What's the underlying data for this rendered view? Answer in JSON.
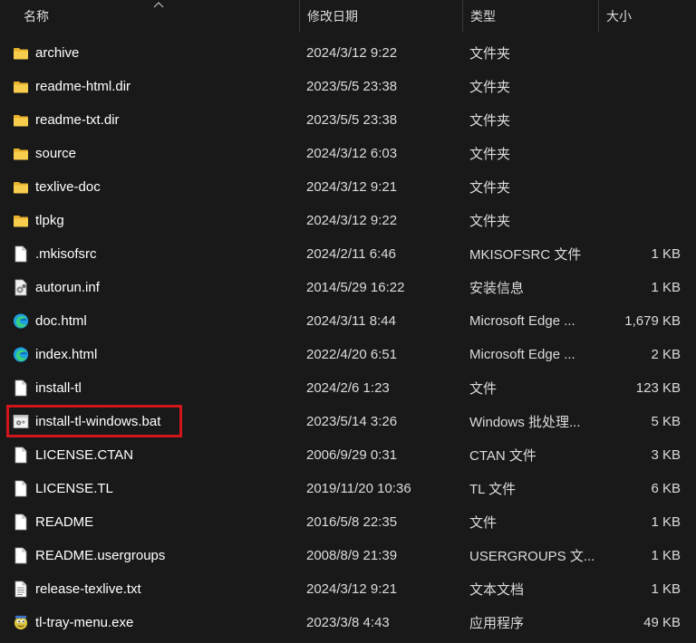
{
  "columns": {
    "name": "名称",
    "date": "修改日期",
    "type": "类型",
    "size": "大小"
  },
  "files": [
    {
      "name": "archive",
      "date": "2024/3/12 9:22",
      "type": "文件夹",
      "size": "",
      "icon": "folder-icon"
    },
    {
      "name": "readme-html.dir",
      "date": "2023/5/5 23:38",
      "type": "文件夹",
      "size": "",
      "icon": "folder-icon"
    },
    {
      "name": "readme-txt.dir",
      "date": "2023/5/5 23:38",
      "type": "文件夹",
      "size": "",
      "icon": "folder-icon"
    },
    {
      "name": "source",
      "date": "2024/3/12 6:03",
      "type": "文件夹",
      "size": "",
      "icon": "folder-icon"
    },
    {
      "name": "texlive-doc",
      "date": "2024/3/12 9:21",
      "type": "文件夹",
      "size": "",
      "icon": "folder-icon"
    },
    {
      "name": "tlpkg",
      "date": "2024/3/12 9:22",
      "type": "文件夹",
      "size": "",
      "icon": "folder-icon"
    },
    {
      "name": ".mkisofsrc",
      "date": "2024/2/11 6:46",
      "type": "MKISOFSRC 文件",
      "size": "1 KB",
      "icon": "file-icon"
    },
    {
      "name": "autorun.inf",
      "date": "2014/5/29 16:22",
      "type": "安装信息",
      "size": "1 KB",
      "icon": "settings-file-icon"
    },
    {
      "name": "doc.html",
      "date": "2024/3/11 8:44",
      "type": "Microsoft Edge ...",
      "size": "1,679 KB",
      "icon": "edge-icon"
    },
    {
      "name": "index.html",
      "date": "2022/4/20 6:51",
      "type": "Microsoft Edge ...",
      "size": "2 KB",
      "icon": "edge-icon"
    },
    {
      "name": "install-tl",
      "date": "2024/2/6 1:23",
      "type": "文件",
      "size": "123 KB",
      "icon": "file-icon"
    },
    {
      "name": "install-tl-windows.bat",
      "date": "2023/5/14 3:26",
      "type": "Windows 批处理...",
      "size": "5 KB",
      "icon": "batch-file-icon"
    },
    {
      "name": "LICENSE.CTAN",
      "date": "2006/9/29 0:31",
      "type": "CTAN 文件",
      "size": "3 KB",
      "icon": "file-icon"
    },
    {
      "name": "LICENSE.TL",
      "date": "2019/11/20 10:36",
      "type": "TL 文件",
      "size": "6 KB",
      "icon": "file-icon"
    },
    {
      "name": "README",
      "date": "2016/5/8 22:35",
      "type": "文件",
      "size": "1 KB",
      "icon": "file-icon"
    },
    {
      "name": "README.usergroups",
      "date": "2008/8/9 21:39",
      "type": "USERGROUPS 文...",
      "size": "1 KB",
      "icon": "file-icon"
    },
    {
      "name": "release-texlive.txt",
      "date": "2024/3/12 9:21",
      "type": "文本文档",
      "size": "1 KB",
      "icon": "text-file-icon"
    },
    {
      "name": "tl-tray-menu.exe",
      "date": "2023/3/8 4:43",
      "type": "应用程序",
      "size": "49 KB",
      "icon": "exe-icon"
    }
  ],
  "colors": {
    "background": "#191919",
    "highlight": "#d0151b",
    "folder": "#f4c63d"
  }
}
